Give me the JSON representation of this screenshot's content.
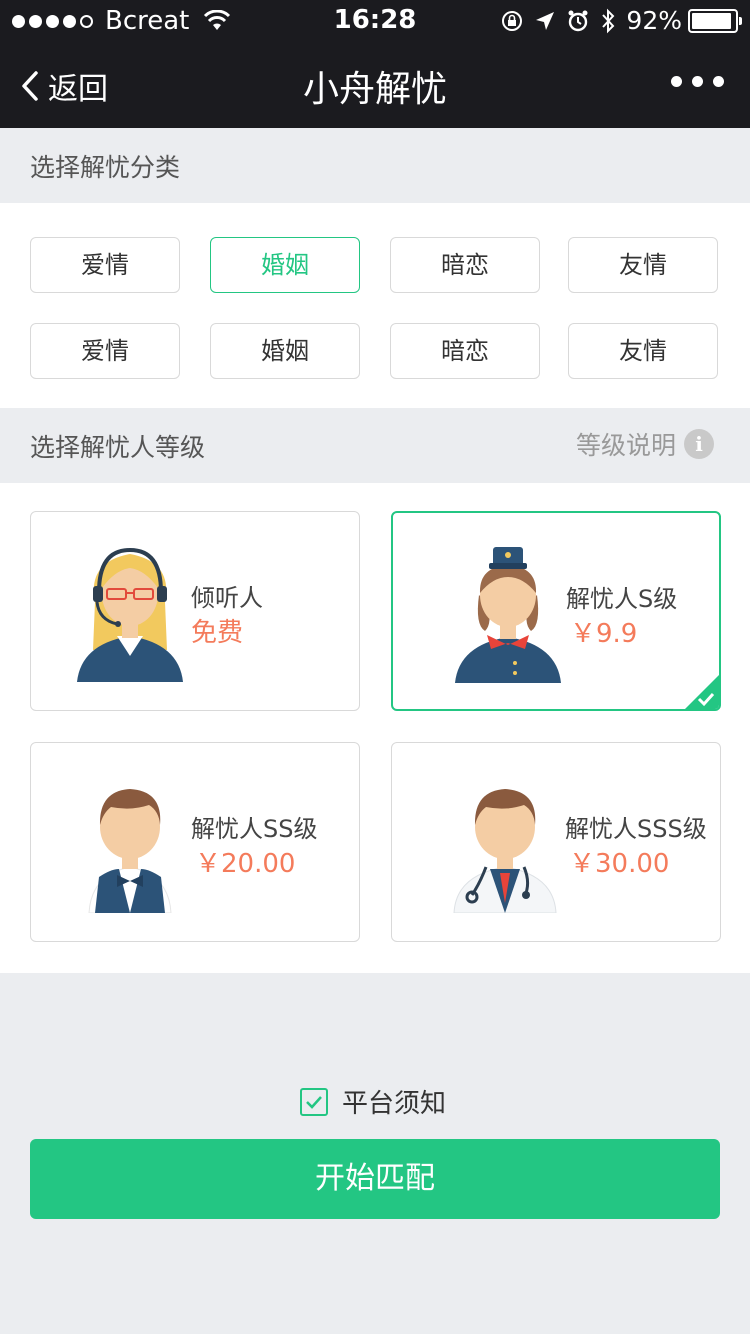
{
  "status_bar": {
    "carrier": "Bcreat",
    "time": "16:28",
    "battery_percent": "92%",
    "battery_level": 0.92
  },
  "nav": {
    "back_label": "返回",
    "title": "小舟解忧"
  },
  "category_section": {
    "heading": "选择解忧分类",
    "tags": [
      {
        "label": "爱情",
        "selected": false
      },
      {
        "label": "婚姻",
        "selected": true
      },
      {
        "label": "暗恋",
        "selected": false
      },
      {
        "label": "友情",
        "selected": false
      },
      {
        "label": "爱情",
        "selected": false
      },
      {
        "label": "婚姻",
        "selected": false
      },
      {
        "label": "暗恋",
        "selected": false
      },
      {
        "label": "友情",
        "selected": false
      }
    ]
  },
  "level_section": {
    "heading": "选择解忧人等级",
    "help_label": "等级说明",
    "levels": [
      {
        "name": "倾听人",
        "price": "免费",
        "avatar": "headset-listener-avatar",
        "selected": false
      },
      {
        "name": "解忧人S级",
        "price": "￥9.9",
        "avatar": "stewardess-avatar",
        "selected": true
      },
      {
        "name": "解忧人SS级",
        "price": "￥20.00",
        "avatar": "waiter-avatar",
        "selected": false
      },
      {
        "name": "解忧人SSS级",
        "price": "￥30.00",
        "avatar": "doctor-avatar",
        "selected": false
      }
    ]
  },
  "agreement": {
    "label": "平台须知",
    "checked": true
  },
  "start_button": {
    "label": "开始匹配"
  },
  "colors": {
    "accent": "#23c683",
    "price": "#f47b5b",
    "topbar": "#1b1b1f"
  }
}
